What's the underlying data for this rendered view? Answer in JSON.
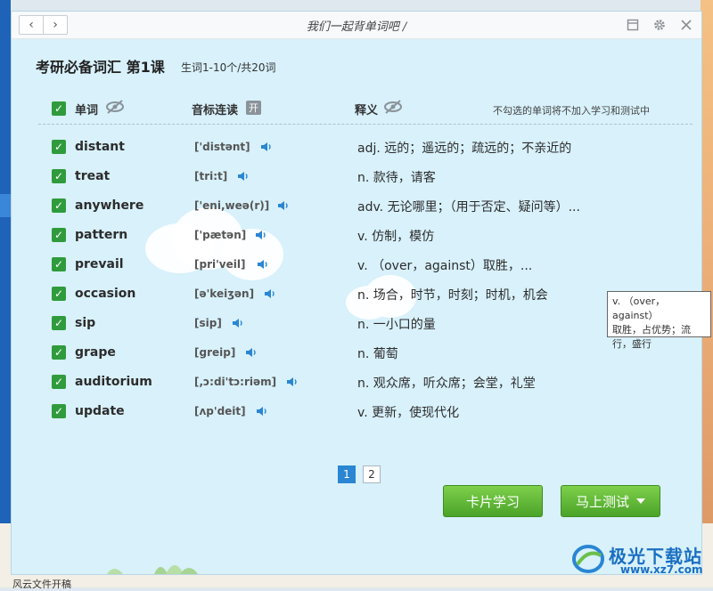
{
  "window": {
    "title": "我们一起背单词吧 /",
    "nav_back": "‹",
    "nav_forward": "›"
  },
  "header": {
    "title": "考研必备词汇 第1课",
    "subtitle": "生词1-10个/共20词"
  },
  "columns": {
    "word": "单词",
    "phonetic": "音标连读",
    "phonetic_toggle": "开",
    "meaning": "释义",
    "hint": "不勾选的单词将不加入学习和测试中"
  },
  "words": [
    {
      "word": "distant",
      "phonetic": "['distənt]",
      "meaning": "adj. 远的；遥远的；疏远的；不亲近的"
    },
    {
      "word": "treat",
      "phonetic": "[tri:t]",
      "meaning": "n. 款待，请客"
    },
    {
      "word": "anywhere",
      "phonetic": "['eni,weə(r)]",
      "meaning": "adv. 无论哪里；（用于否定、疑问等）..."
    },
    {
      "word": "pattern",
      "phonetic": "['pætən]",
      "meaning": "v. 仿制，模仿"
    },
    {
      "word": "prevail",
      "phonetic": "[pri'veil]",
      "meaning": "v. （over，against）取胜，..."
    },
    {
      "word": "occasion",
      "phonetic": "[ə'keiʒən]",
      "meaning": "n. 场合，时节，时刻；时机，机会"
    },
    {
      "word": "sip",
      "phonetic": "[sip]",
      "meaning": "n. 一小口的量"
    },
    {
      "word": "grape",
      "phonetic": "[greip]",
      "meaning": "n. 葡萄"
    },
    {
      "word": "auditorium",
      "phonetic": "[,ɔ:di'tɔ:riəm]",
      "meaning": "n. 观众席，听众席；会堂，礼堂"
    },
    {
      "word": "update",
      "phonetic": "[ʌp'deit]",
      "meaning": "v. 更新，使现代化"
    }
  ],
  "tooltip": {
    "lines": [
      "v. （over，against）",
      "取胜，占优势；流",
      "行，盛行"
    ]
  },
  "pager": {
    "pages": [
      "1",
      "2"
    ],
    "current": "1"
  },
  "actions": {
    "card_study": "卡片学习",
    "test_now": "马上测试"
  },
  "watermark": {
    "name": "极光下载站",
    "url": "www.xz7.com"
  },
  "desktop": {
    "bottom_text": "风云文件开稿"
  },
  "colors": {
    "accent": "#2f9b3c",
    "button_green": "#5bb532",
    "page_active": "#2a86d3",
    "speaker": "#2a86d3"
  }
}
